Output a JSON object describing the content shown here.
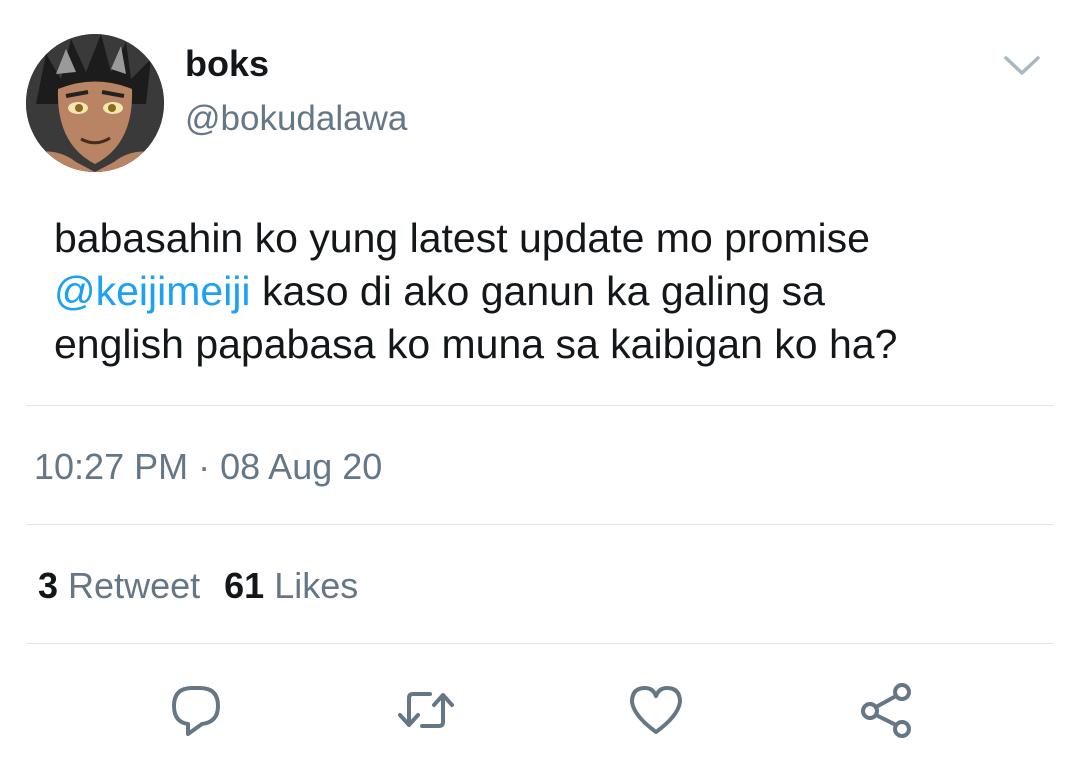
{
  "tweet": {
    "display_name": "boks",
    "handle": "@bokudalawa",
    "text_line1": "babasahin ko yung latest update mo promise",
    "mention": "@keijimeiji",
    "text_line2_rest": " kaso di ako ganun ka galing sa",
    "text_line3": "english papabasa ko muna sa kaibigan ko ha?",
    "time": "10:27 PM",
    "separator": "·",
    "date": "08 Aug 20"
  },
  "stats": {
    "retweets_count": "3",
    "retweets_label": "Retweet",
    "likes_count": "61",
    "likes_label": "Likes"
  },
  "icons": {
    "caret": "chevron-down-icon",
    "reply": "reply-icon",
    "retweet": "retweet-icon",
    "like": "heart-icon",
    "share": "share-icon"
  },
  "colors": {
    "text": "#14171a",
    "secondary": "#657786",
    "mention": "#1da1f2",
    "divider": "#e1e8ed"
  }
}
